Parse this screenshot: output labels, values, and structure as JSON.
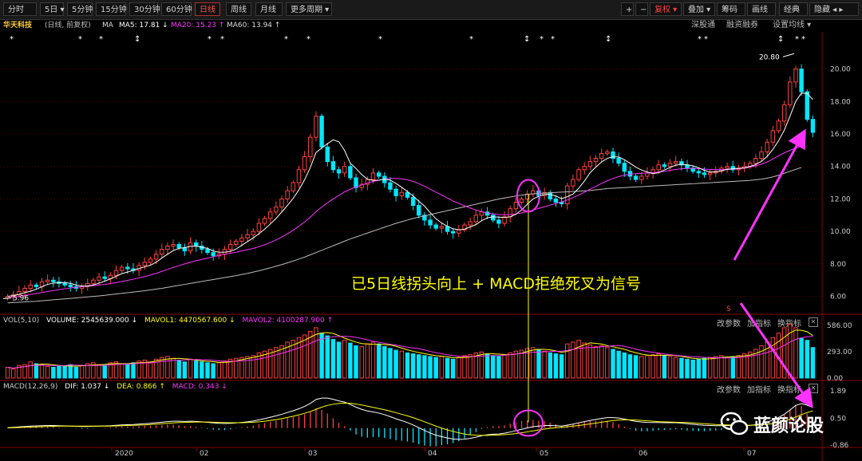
{
  "toolbar": {
    "tabs": [
      "分时",
      "5日 ▾",
      "5分钟",
      "15分钟",
      "30分钟",
      "60分钟",
      "日线",
      "周线",
      "月线",
      "更多周期 ▾"
    ],
    "active_index": 6,
    "right_buttons": [
      "+",
      "−",
      "复权 ▾",
      "叠加 ▾",
      "筹码",
      "画线",
      "经典",
      "隐藏 ◂ ▸"
    ]
  },
  "stock": {
    "name": "华天科技",
    "meta": "(日线, 前复权)",
    "ma_label": "MA",
    "ma5": "MA5: 17.81 ↓",
    "ma20": "MA20: 15.23 ↑",
    "ma60": "MA60: 13.94 ↑"
  },
  "panel_buttons_main": [
    "深股通",
    "融资融券",
    "设置均线 ▾"
  ],
  "price_axis_labels": [
    "20.00",
    "18.00",
    "16.00",
    "14.00",
    "12.00",
    "10.00",
    "8.00",
    "6.00"
  ],
  "price_markers": {
    "high": "20.80",
    "low": "5.96"
  },
  "annotation_text": "已5日线拐头向上 + MACD拒绝死叉为信号",
  "s_marker": "S",
  "volume_panel": {
    "label": "VOL(5,10)",
    "volume": "VOLUME: 2545639.000 ↓",
    "mavol1": "MAVOL1: 4470567.600 ↓",
    "mavol2": "MAVOL2: 4100287.900 ↑",
    "buttons": [
      "改参数",
      "加指标",
      "换指标"
    ],
    "axis_labels": [
      "586.00",
      "293.00",
      "0.00"
    ]
  },
  "macd_panel": {
    "label": "MACD(12,26,9)",
    "dif": "DIF: 1.037 ↓",
    "dea": "DEA: 0.866 ↑",
    "macd": "MACD: 0.343 ↓",
    "buttons": [
      "改参数",
      "加指标",
      "换指标"
    ],
    "axis_labels": [
      "1.89",
      "0.50",
      "-0.86"
    ]
  },
  "x_axis_labels": [
    "2020",
    "02",
    "03",
    "04",
    "05",
    "06",
    "07"
  ],
  "watermark": "蓝颜论股",
  "colors": {
    "up": "#ff4040",
    "down": "#00e6ff",
    "ma5": "#ffffff",
    "ma20": "#ff33ff",
    "ma60": "#bbbbbb",
    "dif": "#ffffff",
    "dea": "#ffff00",
    "annotation": "#ffff00",
    "arrow": "#ff33ff"
  },
  "chart_data": {
    "type": "candlestick",
    "ylim": [
      5.0,
      21.5
    ],
    "volume_ylim": [
      0,
      586
    ],
    "macd_ylim": [
      -0.86,
      1.89
    ],
    "close": [
      6.0,
      6.1,
      6.3,
      6.5,
      6.7,
      6.6,
      6.9,
      7.0,
      6.9,
      6.8,
      6.7,
      6.6,
      6.5,
      6.6,
      6.8,
      7.0,
      7.2,
      7.1,
      7.3,
      7.6,
      7.8,
      7.7,
      7.6,
      7.9,
      8.1,
      8.3,
      8.6,
      8.9,
      9.1,
      9.2,
      9.0,
      8.8,
      9.3,
      9.1,
      8.9,
      8.7,
      8.5,
      8.6,
      8.9,
      9.2,
      9.4,
      9.6,
      9.8,
      10.0,
      10.5,
      10.8,
      11.2,
      11.5,
      12.0,
      12.5,
      13.0,
      13.8,
      14.6,
      15.8,
      17.1,
      15.2,
      14.3,
      13.8,
      13.6,
      14.0,
      13.3,
      12.7,
      12.9,
      13.2,
      13.6,
      13.4,
      13.0,
      12.6,
      12.2,
      12.4,
      12.1,
      11.6,
      11.0,
      10.7,
      10.4,
      10.2,
      10.3,
      10.0,
      9.9,
      10.1,
      10.4,
      10.6,
      11.0,
      11.2,
      11.0,
      10.7,
      10.5,
      10.9,
      11.4,
      11.8,
      12.0,
      12.3,
      12.5,
      12.2,
      12.4,
      12.0,
      11.8,
      11.7,
      12.8,
      13.2,
      13.8,
      14.0,
      14.3,
      14.5,
      14.8,
      14.9,
      14.5,
      14.2,
      13.7,
      13.4,
      13.2,
      13.4,
      13.6,
      13.8,
      14.1,
      14.0,
      14.2,
      14.3,
      14.1,
      13.9,
      13.7,
      13.6,
      13.5,
      13.6,
      13.7,
      13.9,
      14.0,
      13.8,
      13.9,
      14.0,
      14.2,
      14.5,
      14.9,
      15.5,
      16.2,
      16.8,
      17.8,
      19.2,
      20.0,
      18.6,
      16.9,
      16.1
    ],
    "ma5": [
      6.0,
      6.05,
      6.13,
      6.23,
      6.32,
      6.44,
      6.6,
      6.74,
      6.82,
      6.84,
      6.86,
      6.8,
      6.7,
      6.64,
      6.64,
      6.7,
      6.82,
      6.94,
      7.08,
      7.24,
      7.4,
      7.5,
      7.6,
      7.72,
      7.82,
      7.92,
      8.1,
      8.36,
      8.6,
      8.82,
      8.96,
      9.0,
      9.08,
      9.1,
      9.02,
      8.96,
      8.8,
      8.72,
      8.72,
      8.78,
      8.92,
      9.14,
      9.38,
      9.6,
      9.86,
      10.14,
      10.46,
      10.8,
      11.2,
      11.6,
      12.04,
      12.56,
      13.18,
      13.94,
      14.86,
      15.14,
      15.4,
      15.64,
      15.52,
      14.98,
      14.2,
      13.88,
      13.5,
      13.22,
      13.14,
      13.16,
      13.22,
      13.16,
      12.96,
      12.72,
      12.46,
      12.18,
      11.86,
      11.56,
      11.16,
      10.78,
      10.52,
      10.32,
      10.16,
      10.1,
      10.14,
      10.28,
      10.42,
      10.66,
      10.84,
      10.9,
      10.88,
      10.86,
      10.9,
      11.06,
      11.32,
      11.68,
      12.0,
      12.16,
      12.28,
      12.28,
      12.18,
      12.02,
      12.14,
      12.3,
      12.66,
      13.1,
      13.62,
      13.96,
      14.28,
      14.5,
      14.6,
      14.58,
      14.42,
      14.2,
      13.96,
      13.78,
      13.66,
      13.56,
      13.62,
      13.78,
      13.94,
      14.08,
      14.14,
      14.1,
      14.04,
      13.92,
      13.76,
      13.66,
      13.66,
      13.74,
      13.82,
      13.86,
      13.88,
      13.92,
      14.0,
      14.12,
      14.32,
      14.62,
      15.06,
      15.58,
      16.24,
      17.1,
      18.0,
      18.52,
      18.5,
      18.12
    ],
    "ma20": [
      5.9,
      5.95,
      6.0,
      6.06,
      6.12,
      6.18,
      6.24,
      6.3,
      6.36,
      6.42,
      6.47,
      6.52,
      6.56,
      6.6,
      6.63,
      6.66,
      6.7,
      6.74,
      6.79,
      6.85,
      6.92,
      6.99,
      7.06,
      7.14,
      7.22,
      7.32,
      7.42,
      7.54,
      7.66,
      7.78,
      7.9,
      8.0,
      8.1,
      8.2,
      8.28,
      8.36,
      8.44,
      8.52,
      8.6,
      8.66,
      8.72,
      8.8,
      8.88,
      8.96,
      9.06,
      9.18,
      9.32,
      9.48,
      9.66,
      9.86,
      10.08,
      10.32,
      10.58,
      10.88,
      11.22,
      11.5,
      11.76,
      12.0,
      12.22,
      12.44,
      12.6,
      12.74,
      12.86,
      12.98,
      13.08,
      13.16,
      13.22,
      13.26,
      13.26,
      13.24,
      13.18,
      13.08,
      12.94,
      12.78,
      12.6,
      12.42,
      12.24,
      12.06,
      11.88,
      11.72,
      11.58,
      11.44,
      11.32,
      11.22,
      11.14,
      11.08,
      11.04,
      11.02,
      11.04,
      11.08,
      11.14,
      11.22,
      11.32,
      11.42,
      11.52,
      11.62,
      11.72,
      11.82,
      11.94,
      12.08,
      12.24,
      12.42,
      12.6,
      12.78,
      12.96,
      13.12,
      13.26,
      13.38,
      13.46,
      13.52,
      13.56,
      13.58,
      13.6,
      13.62,
      13.66,
      13.7,
      13.76,
      13.82,
      13.86,
      13.88,
      13.88,
      13.86,
      13.84,
      13.82,
      13.8,
      13.8,
      13.82,
      13.84,
      13.86,
      13.9,
      13.96,
      14.04,
      14.14,
      14.28,
      14.46,
      14.66,
      14.84,
      15.0,
      15.14,
      15.23
    ],
    "ma60": [
      5.6,
      5.62,
      5.64,
      5.66,
      5.68,
      5.7,
      5.73,
      5.76,
      5.79,
      5.82,
      5.85,
      5.88,
      5.91,
      5.94,
      5.97,
      6.0,
      6.03,
      6.07,
      6.11,
      6.15,
      6.19,
      6.23,
      6.27,
      6.31,
      6.35,
      6.4,
      6.45,
      6.5,
      6.56,
      6.62,
      6.68,
      6.74,
      6.8,
      6.86,
      6.92,
      6.98,
      7.04,
      7.1,
      7.16,
      7.22,
      7.28,
      7.35,
      7.42,
      7.5,
      7.58,
      7.67,
      7.76,
      7.86,
      7.96,
      8.07,
      8.18,
      8.3,
      8.42,
      8.56,
      8.7,
      8.84,
      8.98,
      9.12,
      9.26,
      9.4,
      9.54,
      9.66,
      9.78,
      9.9,
      10.02,
      10.14,
      10.26,
      10.38,
      10.5,
      10.6,
      10.7,
      10.8,
      10.88,
      10.96,
      11.04,
      11.12,
      11.2,
      11.28,
      11.36,
      11.44,
      11.52,
      11.6,
      11.68,
      11.76,
      11.84,
      11.92,
      12.0,
      12.06,
      12.12,
      12.18,
      12.24,
      12.28,
      12.32,
      12.34,
      12.36,
      12.38,
      12.4,
      12.42,
      12.44,
      12.46,
      12.48,
      12.5,
      12.52,
      12.56,
      12.6,
      12.64,
      12.66,
      12.68,
      12.7,
      12.72,
      12.74,
      12.76,
      12.78,
      12.8,
      12.82,
      12.84,
      12.86,
      12.88,
      12.9,
      12.92,
      12.94,
      12.96,
      12.98,
      13.0,
      13.02,
      13.04,
      13.06,
      13.08,
      13.1,
      13.12,
      13.14,
      13.18,
      13.22,
      13.28,
      13.36,
      13.46,
      13.58,
      13.7,
      13.82,
      13.94
    ],
    "volume": [
      120,
      100,
      140,
      150,
      180,
      160,
      150,
      130,
      120,
      140,
      130,
      150,
      120,
      140,
      160,
      170,
      150,
      140,
      170,
      180,
      160,
      150,
      170,
      190,
      200,
      180,
      210,
      230,
      240,
      220,
      200,
      180,
      210,
      190,
      180,
      170,
      160,
      170,
      190,
      210,
      220,
      230,
      240,
      250,
      280,
      300,
      320,
      340,
      360,
      400,
      420,
      450,
      480,
      520,
      560,
      500,
      470,
      430,
      400,
      420,
      390,
      360,
      350,
      380,
      400,
      380,
      350,
      330,
      310,
      300,
      280,
      270,
      260,
      250,
      240,
      230,
      240,
      220,
      210,
      230,
      250,
      260,
      280,
      290,
      270,
      250,
      240,
      260,
      280,
      300,
      310,
      330,
      340,
      320,
      300,
      280,
      270,
      260,
      380,
      400,
      420,
      390,
      370,
      350,
      360,
      340,
      320,
      300,
      280,
      260,
      250,
      240,
      250,
      260,
      270,
      250,
      240,
      230,
      220,
      210,
      200,
      210,
      220,
      230,
      240,
      250,
      230,
      240,
      250,
      270,
      290,
      320,
      360,
      400,
      450,
      500,
      560,
      600,
      560,
      440,
      420,
      340
    ],
    "dif": [
      0.02,
      0.04,
      0.06,
      0.08,
      0.1,
      0.11,
      0.12,
      0.13,
      0.13,
      0.12,
      0.11,
      0.1,
      0.09,
      0.08,
      0.08,
      0.09,
      0.1,
      0.11,
      0.12,
      0.14,
      0.16,
      0.17,
      0.18,
      0.2,
      0.22,
      0.24,
      0.27,
      0.3,
      0.33,
      0.35,
      0.35,
      0.34,
      0.35,
      0.34,
      0.32,
      0.29,
      0.26,
      0.24,
      0.23,
      0.24,
      0.26,
      0.29,
      0.32,
      0.36,
      0.42,
      0.48,
      0.55,
      0.62,
      0.7,
      0.79,
      0.88,
      0.98,
      1.1,
      1.25,
      1.45,
      1.52,
      1.52,
      1.46,
      1.38,
      1.32,
      1.2,
      1.06,
      0.95,
      0.87,
      0.82,
      0.76,
      0.68,
      0.58,
      0.47,
      0.38,
      0.28,
      0.16,
      0.02,
      -0.12,
      -0.25,
      -0.36,
      -0.43,
      -0.5,
      -0.55,
      -0.57,
      -0.56,
      -0.52,
      -0.46,
      -0.39,
      -0.34,
      -0.31,
      -0.3,
      -0.26,
      -0.2,
      -0.13,
      -0.06,
      0.01,
      0.07,
      0.1,
      0.13,
      0.13,
      0.12,
      0.1,
      0.15,
      0.2,
      0.27,
      0.33,
      0.39,
      0.44,
      0.49,
      0.53,
      0.53,
      0.51,
      0.46,
      0.4,
      0.34,
      0.31,
      0.29,
      0.28,
      0.28,
      0.27,
      0.27,
      0.27,
      0.25,
      0.22,
      0.19,
      0.16,
      0.14,
      0.13,
      0.12,
      0.12,
      0.13,
      0.12,
      0.12,
      0.12,
      0.14,
      0.17,
      0.22,
      0.3,
      0.41,
      0.54,
      0.7,
      0.92,
      1.15,
      1.24,
      1.16,
      1.04
    ],
    "dea": [
      0.01,
      0.02,
      0.03,
      0.04,
      0.05,
      0.06,
      0.07,
      0.08,
      0.09,
      0.1,
      0.1,
      0.1,
      0.1,
      0.1,
      0.1,
      0.1,
      0.1,
      0.1,
      0.1,
      0.11,
      0.12,
      0.13,
      0.14,
      0.15,
      0.16,
      0.18,
      0.2,
      0.22,
      0.24,
      0.26,
      0.28,
      0.29,
      0.3,
      0.31,
      0.31,
      0.31,
      0.3,
      0.29,
      0.28,
      0.27,
      0.27,
      0.27,
      0.28,
      0.3,
      0.32,
      0.35,
      0.39,
      0.43,
      0.48,
      0.54,
      0.6,
      0.67,
      0.75,
      0.84,
      0.95,
      1.06,
      1.15,
      1.21,
      1.25,
      1.27,
      1.26,
      1.22,
      1.17,
      1.11,
      1.05,
      0.99,
      0.93,
      0.86,
      0.78,
      0.7,
      0.62,
      0.53,
      0.43,
      0.32,
      0.21,
      0.1,
      0.0,
      -0.09,
      -0.17,
      -0.24,
      -0.3,
      -0.34,
      -0.36,
      -0.37,
      -0.37,
      -0.36,
      -0.35,
      -0.33,
      -0.31,
      -0.28,
      -0.24,
      -0.19,
      -0.14,
      -0.09,
      -0.05,
      -0.01,
      0.02,
      0.04,
      0.07,
      0.1,
      0.13,
      0.17,
      0.21,
      0.25,
      0.3,
      0.34,
      0.38,
      0.41,
      0.42,
      0.42,
      0.41,
      0.39,
      0.37,
      0.35,
      0.33,
      0.32,
      0.31,
      0.3,
      0.29,
      0.28,
      0.26,
      0.24,
      0.22,
      0.2,
      0.18,
      0.17,
      0.16,
      0.15,
      0.14,
      0.14,
      0.14,
      0.15,
      0.16,
      0.19,
      0.23,
      0.29,
      0.36,
      0.45,
      0.56,
      0.68,
      0.79,
      0.87
    ]
  }
}
